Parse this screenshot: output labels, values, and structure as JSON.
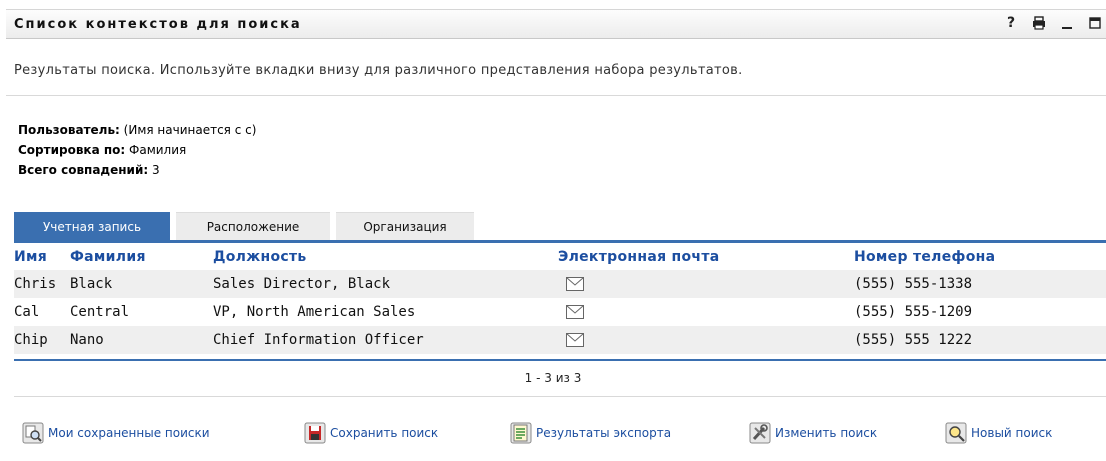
{
  "portlet": {
    "title": "Список контекстов для поиска",
    "help_icon": "question-mark-icon",
    "print_icon": "printer-icon",
    "minimize_icon": "minimize-icon",
    "maximize_icon": "maximize-icon",
    "help_label": "?"
  },
  "description": "Результаты поиска. Используйте вкладки внизу для различного представления набора результатов.",
  "summary": {
    "user_label": "Пользователь:",
    "user_value": "(Имя начинается с c)",
    "sort_label": "Сортировка по:",
    "sort_value": "Фамилия",
    "total_label": "Всего совпадений:",
    "total_value": "3"
  },
  "tabs": [
    {
      "label": "Учетная запись",
      "active": true
    },
    {
      "label": "Расположение",
      "active": false
    },
    {
      "label": "Организация",
      "active": false
    }
  ],
  "table": {
    "headers": [
      "Имя",
      "Фамилия",
      "Должность",
      "Электронная почта",
      "Номер телефона"
    ],
    "rows": [
      {
        "first": "Chris",
        "last": "Black",
        "title": "Sales Director, Black",
        "email_icon": "envelope-icon",
        "phone": "(555) 555-1338"
      },
      {
        "first": "Cal",
        "last": "Central",
        "title": "VP, North American Sales",
        "email_icon": "envelope-icon",
        "phone": "(555) 555-1209"
      },
      {
        "first": "Chip",
        "last": "Nano",
        "title": "Chief Information Officer",
        "email_icon": "envelope-icon",
        "phone": "(555) 555 1222"
      }
    ]
  },
  "pager": "1 - 3 из 3",
  "actions": [
    {
      "label": "Мои сохраненные поиски",
      "icon": "saved-searches-icon"
    },
    {
      "label": "Сохранить поиск",
      "icon": "save-icon"
    },
    {
      "label": "Результаты экспорта",
      "icon": "export-icon"
    },
    {
      "label": "Изменить поиск",
      "icon": "edit-search-icon"
    },
    {
      "label": "Новый поиск",
      "icon": "new-search-icon"
    }
  ],
  "colors": {
    "accent": "#3a6fb0",
    "link": "#1c4ea0",
    "row_alt": "#efefef"
  }
}
